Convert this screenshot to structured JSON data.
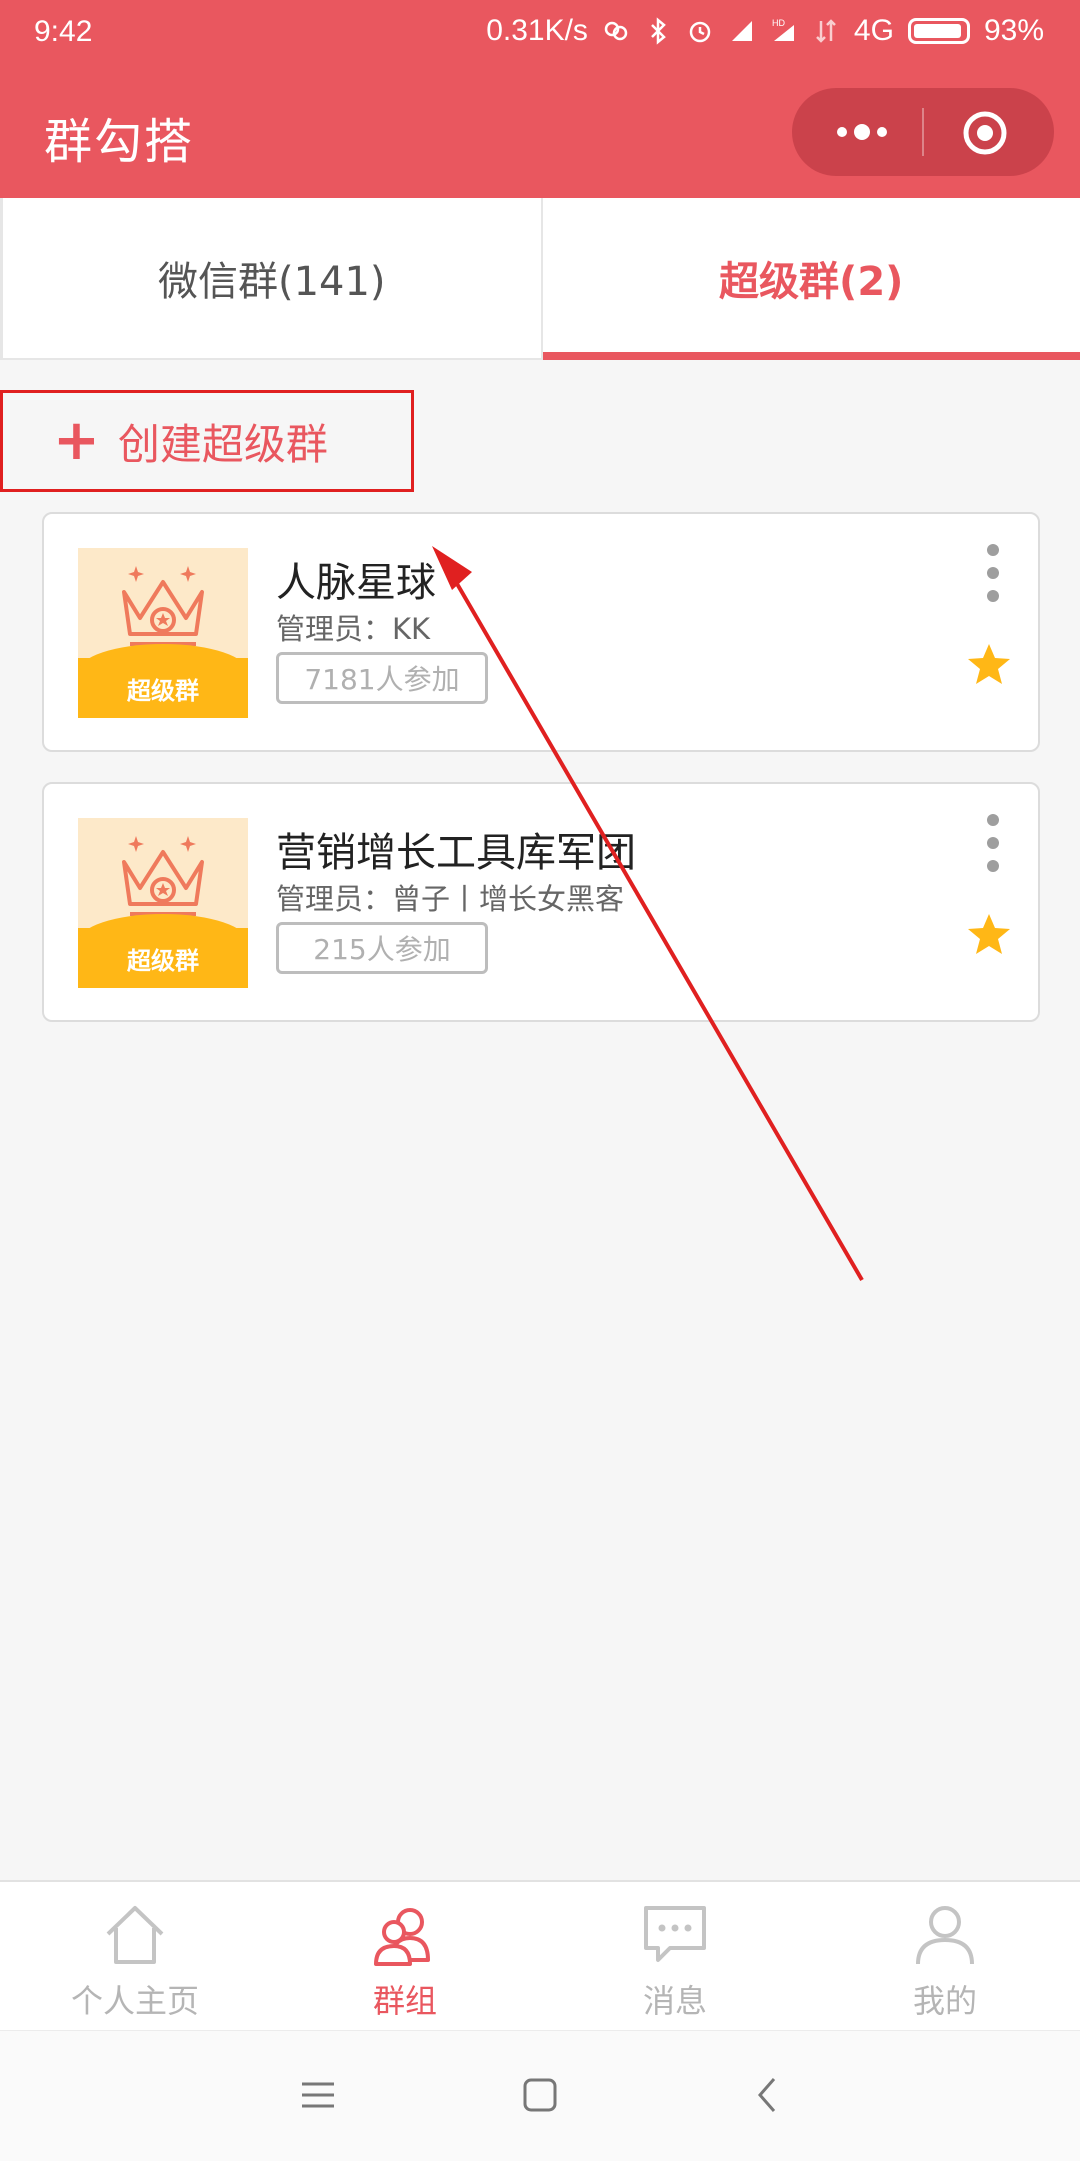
{
  "status_bar": {
    "time": "9:42",
    "net_speed": "0.31K/s",
    "network": "4G",
    "battery": "93%"
  },
  "app": {
    "title": "群勾搭"
  },
  "tabs": [
    {
      "label": "微信群(141)",
      "active": false
    },
    {
      "label": "超级群(2)",
      "active": true
    }
  ],
  "create_button": {
    "label": "创建超级群"
  },
  "groups": [
    {
      "name": "人脉星球",
      "admin": "管理员：KK",
      "members": "7181人参加",
      "badge": "超级群",
      "starred": true
    },
    {
      "name": "营销增长工具库军团",
      "admin": "管理员：曾子丨增长女黑客",
      "members": "215人参加",
      "badge": "超级群",
      "starred": true
    }
  ],
  "bottom_nav": [
    {
      "label": "个人主页",
      "icon": "home-icon",
      "active": false
    },
    {
      "label": "群组",
      "icon": "group-icon",
      "active": true
    },
    {
      "label": "消息",
      "icon": "message-icon",
      "active": false
    },
    {
      "label": "我的",
      "icon": "profile-icon",
      "active": false
    }
  ],
  "colors": {
    "brand": "#e9575f",
    "star": "#ffb716",
    "annotation": "#e02020"
  }
}
